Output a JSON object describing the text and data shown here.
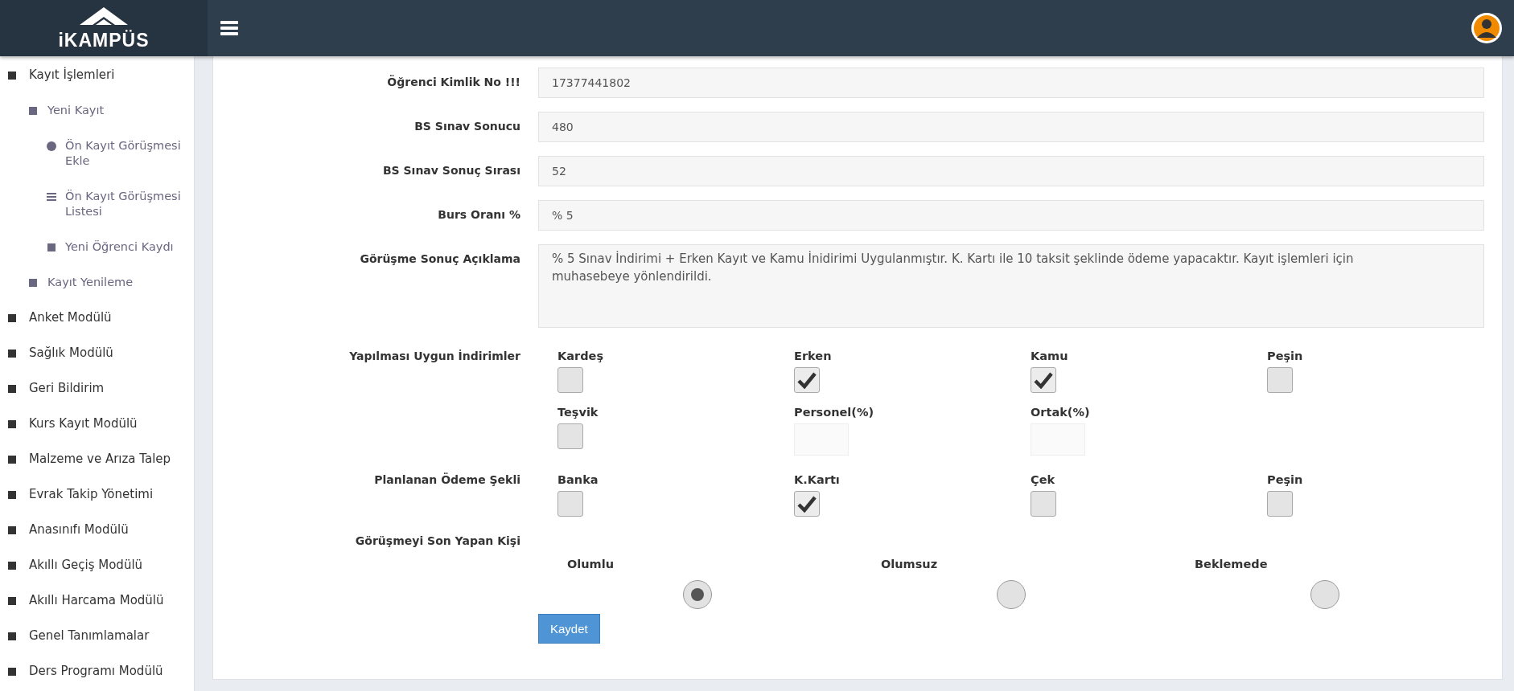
{
  "logo": {
    "text": "iKAMPÜS"
  },
  "sidebar": {
    "items": [
      {
        "label": "Kayıt İşlemleri",
        "children": [
          {
            "label": "Yeni Kayıt",
            "children": [
              {
                "label": "Ön Kayıt Görüşmesi Ekle"
              },
              {
                "label": "Ön Kayıt Görüşmesi Listesi"
              },
              {
                "label": "Yeni Öğrenci Kaydı"
              }
            ]
          },
          {
            "label": "Kayıt Yenileme"
          }
        ]
      },
      {
        "label": "Anket Modülü"
      },
      {
        "label": "Sağlık Modülü"
      },
      {
        "label": "Geri Bildirim"
      },
      {
        "label": "Kurs Kayıt Modülü"
      },
      {
        "label": "Malzeme ve Arıza Talep"
      },
      {
        "label": "Evrak Takip Yönetimi"
      },
      {
        "label": "Anasınıfı Modülü"
      },
      {
        "label": "Akıllı Geçiş Modülü"
      },
      {
        "label": "Akıllı Harcama Modülü"
      },
      {
        "label": "Genel Tanımlamalar"
      },
      {
        "label": "Ders Programı Modülü"
      }
    ]
  },
  "fields": [
    {
      "label": "Öğrenci Kimlik No !!!",
      "value": "17377441802",
      "kind": "input"
    },
    {
      "label": "BS Sınav Sonucu",
      "value": "480",
      "kind": "input"
    },
    {
      "label": "BS Sınav Sonuç Sırası",
      "value": "52",
      "kind": "input"
    },
    {
      "label": "Burs Oranı %",
      "value": "% 5",
      "kind": "input"
    },
    {
      "label": "Görüşme Sonuç Açıklama",
      "value": "% 5 Sınav İndirimi + Erken Kayıt ve Kamu İnidirimi Uygulanmıştır. K. Kartı ile 10 taksit şeklinde ödeme yapacaktır.  Kayıt işlemleri için muhasebeye yönlendirildi.",
      "kind": "textarea"
    }
  ],
  "discounts": {
    "label": "Yapılması Uygun İndirimler",
    "items": [
      {
        "label": "Kardeş",
        "kind": "checkbox",
        "checked": false
      },
      {
        "label": "Erken",
        "kind": "checkbox",
        "checked": true
      },
      {
        "label": "Kamu",
        "kind": "checkbox",
        "checked": true
      },
      {
        "label": "Peşin",
        "kind": "checkbox",
        "checked": false
      },
      {
        "label": "Teşvik",
        "kind": "checkbox",
        "checked": false
      },
      {
        "label": "Personel(%)",
        "kind": "input"
      },
      {
        "label": "Ortak(%)",
        "kind": "input"
      }
    ]
  },
  "payment": {
    "label": "Planlanan Ödeme Şekli",
    "items": [
      {
        "label": "Banka",
        "kind": "checkbox",
        "checked": false
      },
      {
        "label": "K.Kartı",
        "kind": "checkbox",
        "checked": true
      },
      {
        "label": "Çek",
        "kind": "checkbox",
        "checked": false
      },
      {
        "label": "Peşin",
        "kind": "checkbox",
        "checked": false
      }
    ]
  },
  "interviewer": {
    "label": "Görüşmeyi Son Yapan Kişi"
  },
  "result": {
    "options": [
      {
        "label": "Olumlu",
        "selected": true
      },
      {
        "label": "Olumsuz",
        "selected": false
      },
      {
        "label": "Beklemede",
        "selected": false
      }
    ]
  },
  "save_button": "Kaydet"
}
